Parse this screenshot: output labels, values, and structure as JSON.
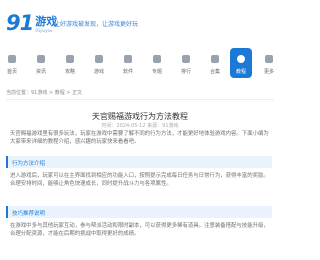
{
  "header": {
    "logo_number": "91",
    "logo_text": "游戏",
    "logo_sub": "91jiuyou",
    "slogan": "让好游戏被发现，让游戏更好玩"
  },
  "nav": {
    "items": [
      {
        "label": "首页"
      },
      {
        "label": "资讯"
      },
      {
        "label": "攻略"
      },
      {
        "label": "游戏"
      },
      {
        "label": "软件"
      },
      {
        "label": "专题"
      },
      {
        "label": "排行"
      },
      {
        "label": "合集"
      },
      {
        "label": "教程"
      },
      {
        "label": "更多"
      }
    ],
    "active_index": 8
  },
  "breadcrumb": "当前位置：91游戏 > 教程 > 正文",
  "article": {
    "title": "天官赐福游戏行为方法教程",
    "meta": "时间：2024-05-12 来源：91游戏",
    "intro": "天官赐福游戏里有很多玩法，玩家在游戏中需要了解不同的行为方法，才能更好地体验游戏内容。下面小编为大家带来详细的教程介绍，感兴趣的玩家快来看看吧。",
    "sections": [
      {
        "heading": "行为方法介绍",
        "body": "进入游戏后，玩家可以在主界面找到相应的功能入口，按照提示完成每日任务与日常行为，获得丰富的奖励。合理安排时间，能够让角色快速成长，同时提升战斗力与各项属性。"
      },
      {
        "heading": "技巧推荐说明",
        "body": "在游戏中多与其他玩家互动，参与帮派活动和限时副本，可以获得更多稀有道具。注意装备搭配与技能升级，合理分配资源，才能在后期的挑战中取得更好的成绩。"
      }
    ]
  }
}
